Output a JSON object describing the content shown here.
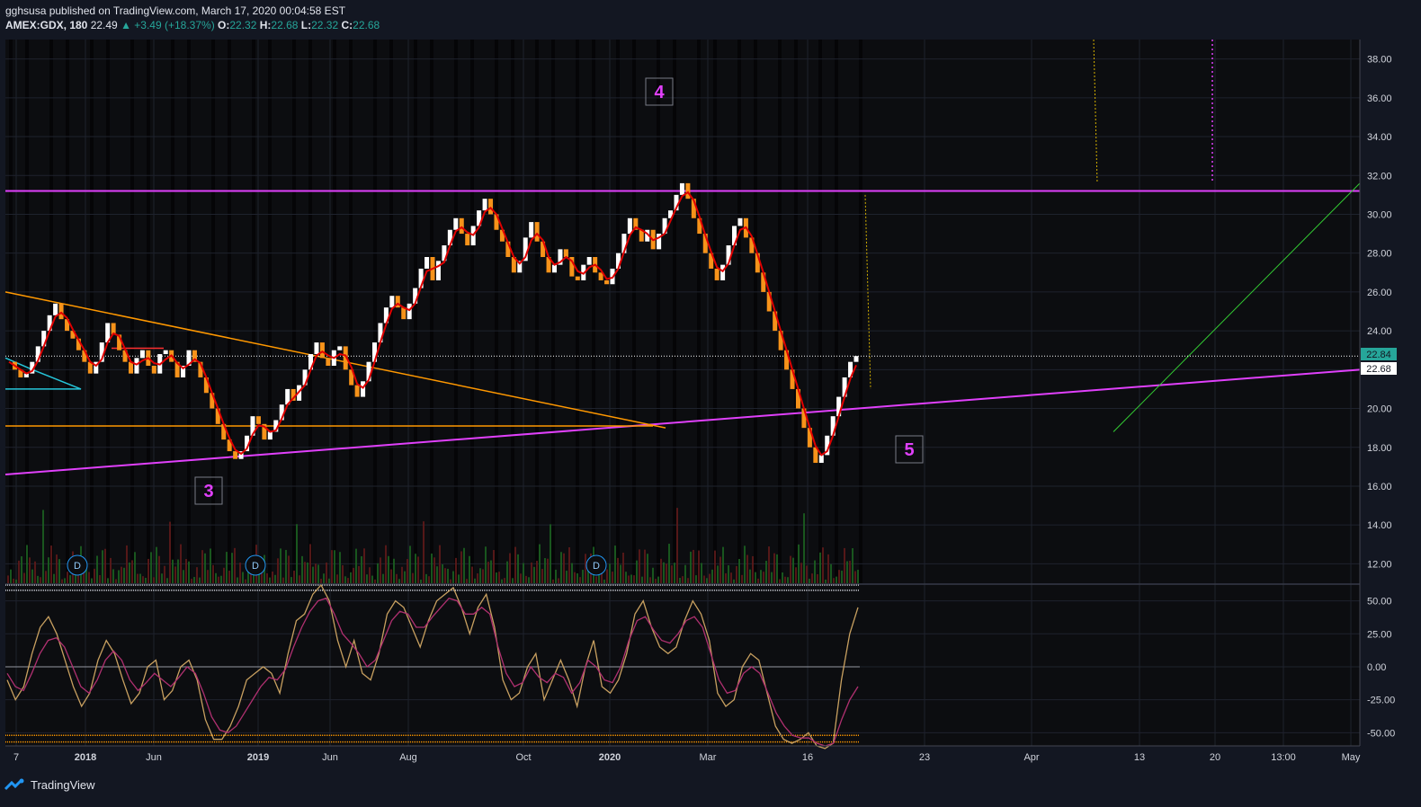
{
  "header": {
    "published_line": "gghsusa published on TradingView.com, March 17, 2020 00:04:58 EST",
    "symbol": "AMEX:GDX, 180",
    "last": "22.49",
    "change": "▲ +3.49 (+18.37%)",
    "o_label": "O:",
    "o": "22.32",
    "h_label": "H:",
    "h": "22.68",
    "l_label": "L:",
    "l": "22.32",
    "c_label": "C:",
    "c": "22.68"
  },
  "footer": {
    "brand": "TradingView"
  },
  "colors": {
    "background": "#131722",
    "bull_brick": "#ffffff",
    "bear_brick": "#f7931a",
    "ma_line": "#e00000",
    "magenta": "#e040fb",
    "orange_line": "#ff9800",
    "cyan": "#26c6da",
    "green": "#33cc33",
    "osc_fast": "#c8a060",
    "osc_slow": "#b03070"
  },
  "annotations": {
    "wave_3": "3",
    "wave_4": "4",
    "wave_5": "5",
    "dividend_marker": "D"
  },
  "price_tags": {
    "upper": "22.84",
    "lower": "22.68"
  },
  "chart_data": [
    {
      "type": "line",
      "panel": "price",
      "y_ticks": [
        "38.00",
        "36.00",
        "34.00",
        "32.00",
        "30.00",
        "28.00",
        "26.00",
        "24.00",
        "22.00",
        "20.00",
        "18.00",
        "16.00",
        "14.00",
        "12.00"
      ],
      "ylim": [
        11,
        39
      ],
      "x_ticks": [
        "7",
        "2018",
        "Jun",
        "2019",
        "Jun",
        "Aug",
        "Oct",
        "2020",
        "Mar",
        "16",
        "23",
        "Apr",
        "13",
        "20",
        "13:00",
        "May"
      ],
      "series": [
        {
          "values": [
            22.4,
            22.0,
            21.6,
            21.8,
            22.4,
            23.2,
            24.0,
            24.8,
            25.4,
            24.6,
            24.0,
            23.6,
            23.0,
            22.4,
            21.8,
            22.4,
            23.4,
            24.4,
            23.8,
            23.0,
            22.4,
            21.8,
            22.6,
            23.0,
            22.2,
            21.8,
            22.8,
            23.0,
            22.4,
            21.6,
            22.2,
            23.0,
            22.4,
            21.6,
            20.8,
            20.0,
            19.2,
            18.4,
            17.8,
            17.4,
            17.8,
            18.6,
            19.6,
            19.2,
            18.4,
            18.8,
            19.4,
            20.2,
            21.0,
            20.4,
            21.2,
            22.0,
            22.8,
            23.4,
            22.6,
            22.2,
            23.0,
            23.2,
            22.0,
            21.2,
            20.6,
            21.4,
            22.4,
            23.4,
            24.4,
            25.2,
            25.8,
            25.2,
            24.6,
            25.4,
            26.2,
            27.2,
            27.8,
            26.6,
            27.6,
            28.4,
            29.2,
            29.8,
            29.0,
            28.4,
            29.4,
            30.2,
            30.8,
            30.0,
            29.2,
            28.6,
            27.8,
            27.0,
            27.6,
            28.8,
            29.6,
            28.6,
            27.8,
            27.0,
            27.4,
            28.2,
            27.8,
            26.8,
            26.6,
            27.4,
            27.8,
            27.0,
            26.6,
            26.4,
            27.2,
            28.0,
            29.0,
            29.8,
            29.2,
            28.6,
            29.2,
            28.2,
            29.0,
            29.8,
            30.2,
            31.0,
            31.6,
            30.8,
            29.8,
            29.0,
            28.0,
            27.2,
            26.6,
            27.4,
            28.4,
            29.4,
            29.8,
            28.8,
            28.0,
            27.0,
            26.0,
            25.0,
            24.0,
            23.0,
            22.0,
            21.0,
            20.0,
            19.0,
            18.0,
            17.2,
            17.6,
            18.6,
            19.6,
            20.6,
            21.6,
            22.4,
            22.7
          ]
        }
      ]
    },
    {
      "type": "line",
      "panel": "oscillator",
      "y_ticks": [
        "50.00",
        "25.00",
        "0.00",
        "-25.00",
        "-50.00"
      ],
      "ylim": [
        -60,
        62
      ],
      "series": [
        {
          "values": [
            -10,
            -25,
            -15,
            10,
            30,
            38,
            25,
            5,
            -15,
            -30,
            -20,
            5,
            20,
            10,
            -10,
            -28,
            -20,
            0,
            5,
            -25,
            -18,
            0,
            5,
            -10,
            -40,
            -55,
            -55,
            -45,
            -30,
            -10,
            -5,
            0,
            -5,
            -20,
            10,
            35,
            40,
            55,
            62,
            50,
            20,
            0,
            20,
            -5,
            -10,
            10,
            40,
            50,
            45,
            30,
            15,
            35,
            50,
            55,
            60,
            45,
            25,
            45,
            55,
            30,
            -10,
            -25,
            -20,
            0,
            10,
            -25,
            -10,
            5,
            -10,
            -30,
            0,
            20,
            -15,
            -20,
            -10,
            10,
            40,
            50,
            30,
            15,
            10,
            15,
            35,
            50,
            40,
            20,
            -20,
            -30,
            -25,
            0,
            10,
            5,
            -20,
            -45,
            -55,
            -58,
            -55,
            -50,
            -60,
            -62,
            -58,
            -10,
            25,
            45
          ]
        },
        {
          "values": [
            -5,
            -15,
            -18,
            -5,
            10,
            20,
            22,
            15,
            0,
            -15,
            -20,
            -10,
            5,
            12,
            5,
            -10,
            -18,
            -12,
            -5,
            -10,
            -15,
            -8,
            0,
            -5,
            -20,
            -38,
            -48,
            -50,
            -45,
            -35,
            -25,
            -15,
            -8,
            -10,
            -2,
            15,
            30,
            42,
            50,
            52,
            40,
            25,
            18,
            10,
            0,
            5,
            20,
            35,
            42,
            40,
            30,
            30,
            38,
            45,
            52,
            50,
            40,
            40,
            45,
            40,
            15,
            -5,
            -15,
            -12,
            0,
            -8,
            -12,
            -5,
            -8,
            -20,
            -12,
            5,
            0,
            -10,
            -12,
            0,
            20,
            35,
            38,
            28,
            20,
            18,
            25,
            35,
            38,
            30,
            10,
            -10,
            -20,
            -18,
            -5,
            0,
            -5,
            -20,
            -35,
            -45,
            -52,
            -54,
            -54,
            -58,
            -60,
            -58,
            -40,
            -25,
            -15
          ]
        }
      ]
    }
  ]
}
